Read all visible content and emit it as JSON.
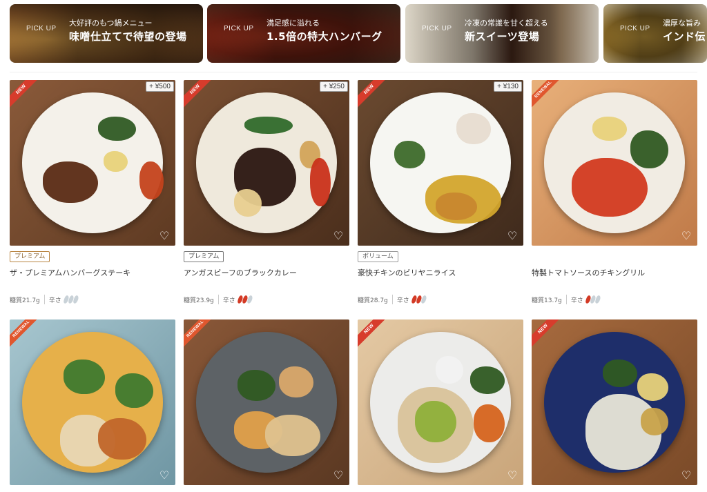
{
  "banners": [
    {
      "pick": "PICK UP",
      "sub": "大好評のもつ鍋メニュー",
      "main": "味噌仕立てで待望の登場"
    },
    {
      "pick": "PICK UP",
      "sub": "満足感に溢れる",
      "main": "1.5倍の特大ハンバーグ"
    },
    {
      "pick": "PICK UP",
      "sub": "冷凍の常識を甘く超える",
      "main": "新スイーツ登場"
    },
    {
      "pick": "PICK UP",
      "sub": "濃厚な旨み",
      "main": "インド伝"
    }
  ],
  "products": [
    {
      "ribbon": "NEW",
      "price": "+ ¥500",
      "badge": "プレミアム",
      "name": "ザ・プレミアムハンバーグステーキ",
      "carbs": "糖質21.7g",
      "spicy_label": "辛さ",
      "spicy_level": 0
    },
    {
      "ribbon": "NEW",
      "price": "+ ¥250",
      "badge": "プレミアム",
      "name": "アンガスビーフのブラックカレー",
      "carbs": "糖質23.9g",
      "spicy_label": "辛さ",
      "spicy_level": 2
    },
    {
      "ribbon": "NEW",
      "price": "+ ¥130",
      "badge": "ボリューム",
      "name": "豪快チキンのビリヤニライス",
      "carbs": "糖質28.7g",
      "spicy_label": "辛さ",
      "spicy_level": 2
    },
    {
      "ribbon": "RENEWAL",
      "price": "",
      "badge": "",
      "name": "特製トマトソースのチキングリル",
      "carbs": "糖質13.7g",
      "spicy_label": "辛さ",
      "spicy_level": 1
    },
    {
      "ribbon": "RENEWAL",
      "price": "",
      "badge": "",
      "name": "",
      "carbs": "",
      "spicy_label": "",
      "spicy_level": 0
    },
    {
      "ribbon": "RENEWAL",
      "price": "",
      "badge": "",
      "name": "",
      "carbs": "",
      "spicy_label": "",
      "spicy_level": 0
    },
    {
      "ribbon": "NEW",
      "price": "",
      "badge": "",
      "name": "",
      "carbs": "",
      "spicy_label": "",
      "spicy_level": 0
    },
    {
      "ribbon": "NEW",
      "price": "",
      "badge": "",
      "name": "",
      "carbs": "",
      "spicy_label": "",
      "spicy_level": 0
    }
  ],
  "icons": {
    "favorite": "heart-outline-icon",
    "spicy": "chili-pepper-icon"
  },
  "colors": {
    "ribbon_new": "#d73c2c",
    "ribbon_renewal": "#e0572e",
    "premium_border": "#b8833f",
    "chili": "#d33a25"
  }
}
